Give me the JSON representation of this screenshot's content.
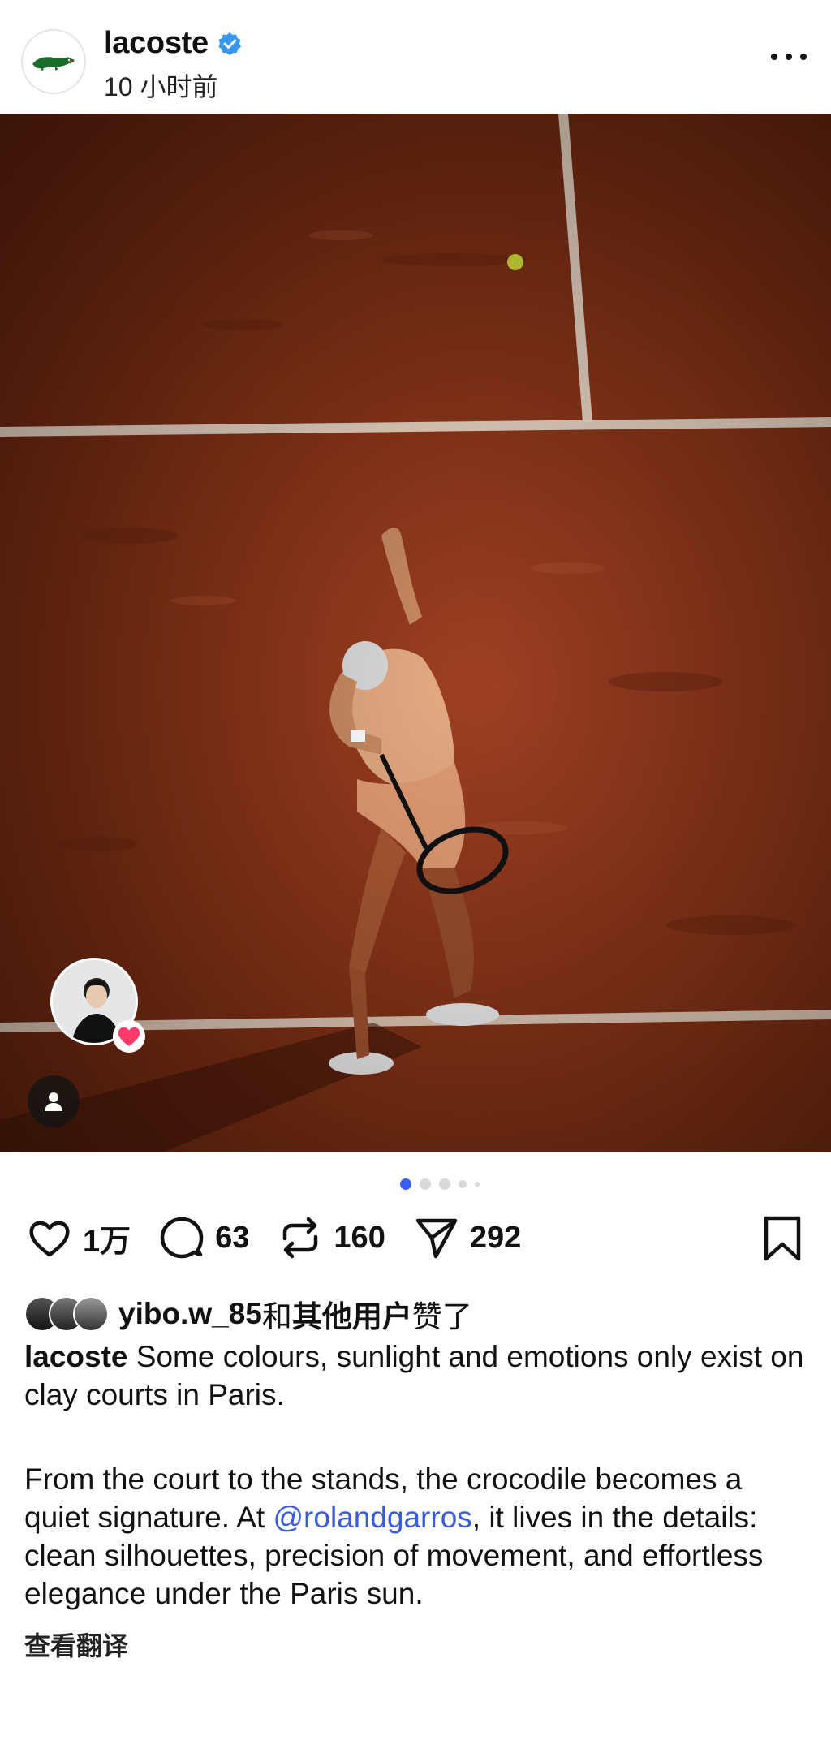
{
  "header": {
    "username": "lacoste",
    "time": "10 小时前",
    "avatar_icon": "crocodile-logo-icon",
    "verified_icon": "verified-badge-icon",
    "more_icon": "more-options-icon"
  },
  "photo": {
    "description_icon": "clay-court-serve-photo",
    "pagination": {
      "total": 5,
      "active_index": 0
    }
  },
  "actions": {
    "likes": "1万",
    "comments": "63",
    "reposts": "160",
    "shares": "292"
  },
  "liked_by": {
    "user": "yibo.w_85",
    "connector": "和",
    "others": "其他用户",
    "suffix": "赞了"
  },
  "caption": {
    "author": "lacoste",
    "line1": " Some colours, sunlight and emotions only exist on clay courts in Paris.",
    "p2_start": "From the court to the stands, the crocodile becomes a quiet signature. At ",
    "mention": "@rolandgarros",
    "p2_end": ", it lives in the details: clean silhouettes, precision of movement, and effortless elegance under the Paris sun.",
    "translate": "查看翻译"
  },
  "colors": {
    "accent": "#3b5bfd",
    "mention": "#3b5bdd",
    "clay": "#8a3519",
    "verified": "#3797f0",
    "heart_badge": "#ff3b6b"
  }
}
